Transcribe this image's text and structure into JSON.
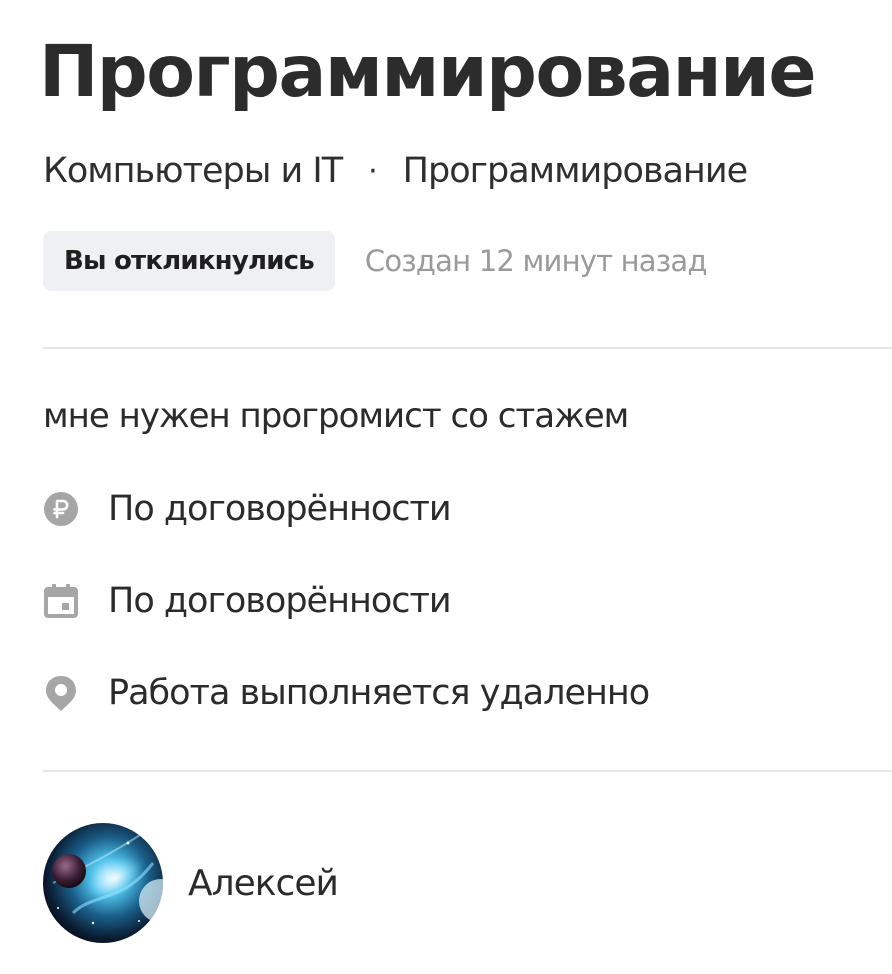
{
  "order": {
    "title": "Программирование",
    "breadcrumb": {
      "category": "Компьютеры и IT",
      "separator": "·",
      "subcategory": "Программирование"
    },
    "status_badge": "Вы откликнулись",
    "created": "Создан 12 минут назад",
    "description": "мне нужен прогромист со стажем",
    "details": [
      {
        "icon": "ruble-icon",
        "text": "По договорённости"
      },
      {
        "icon": "calendar-icon",
        "text": "По договорённости"
      },
      {
        "icon": "location-pin-icon",
        "text": "Работа выполняется удаленно"
      }
    ],
    "author": {
      "name": "Алексей",
      "avatar_icon": "avatar-image"
    }
  },
  "colors": {
    "text": "#2b2b2b",
    "muted": "#9a9a9a",
    "badge_bg": "#eef0f4",
    "icon": "#a6a6a6",
    "divider": "#e8e8e8"
  }
}
